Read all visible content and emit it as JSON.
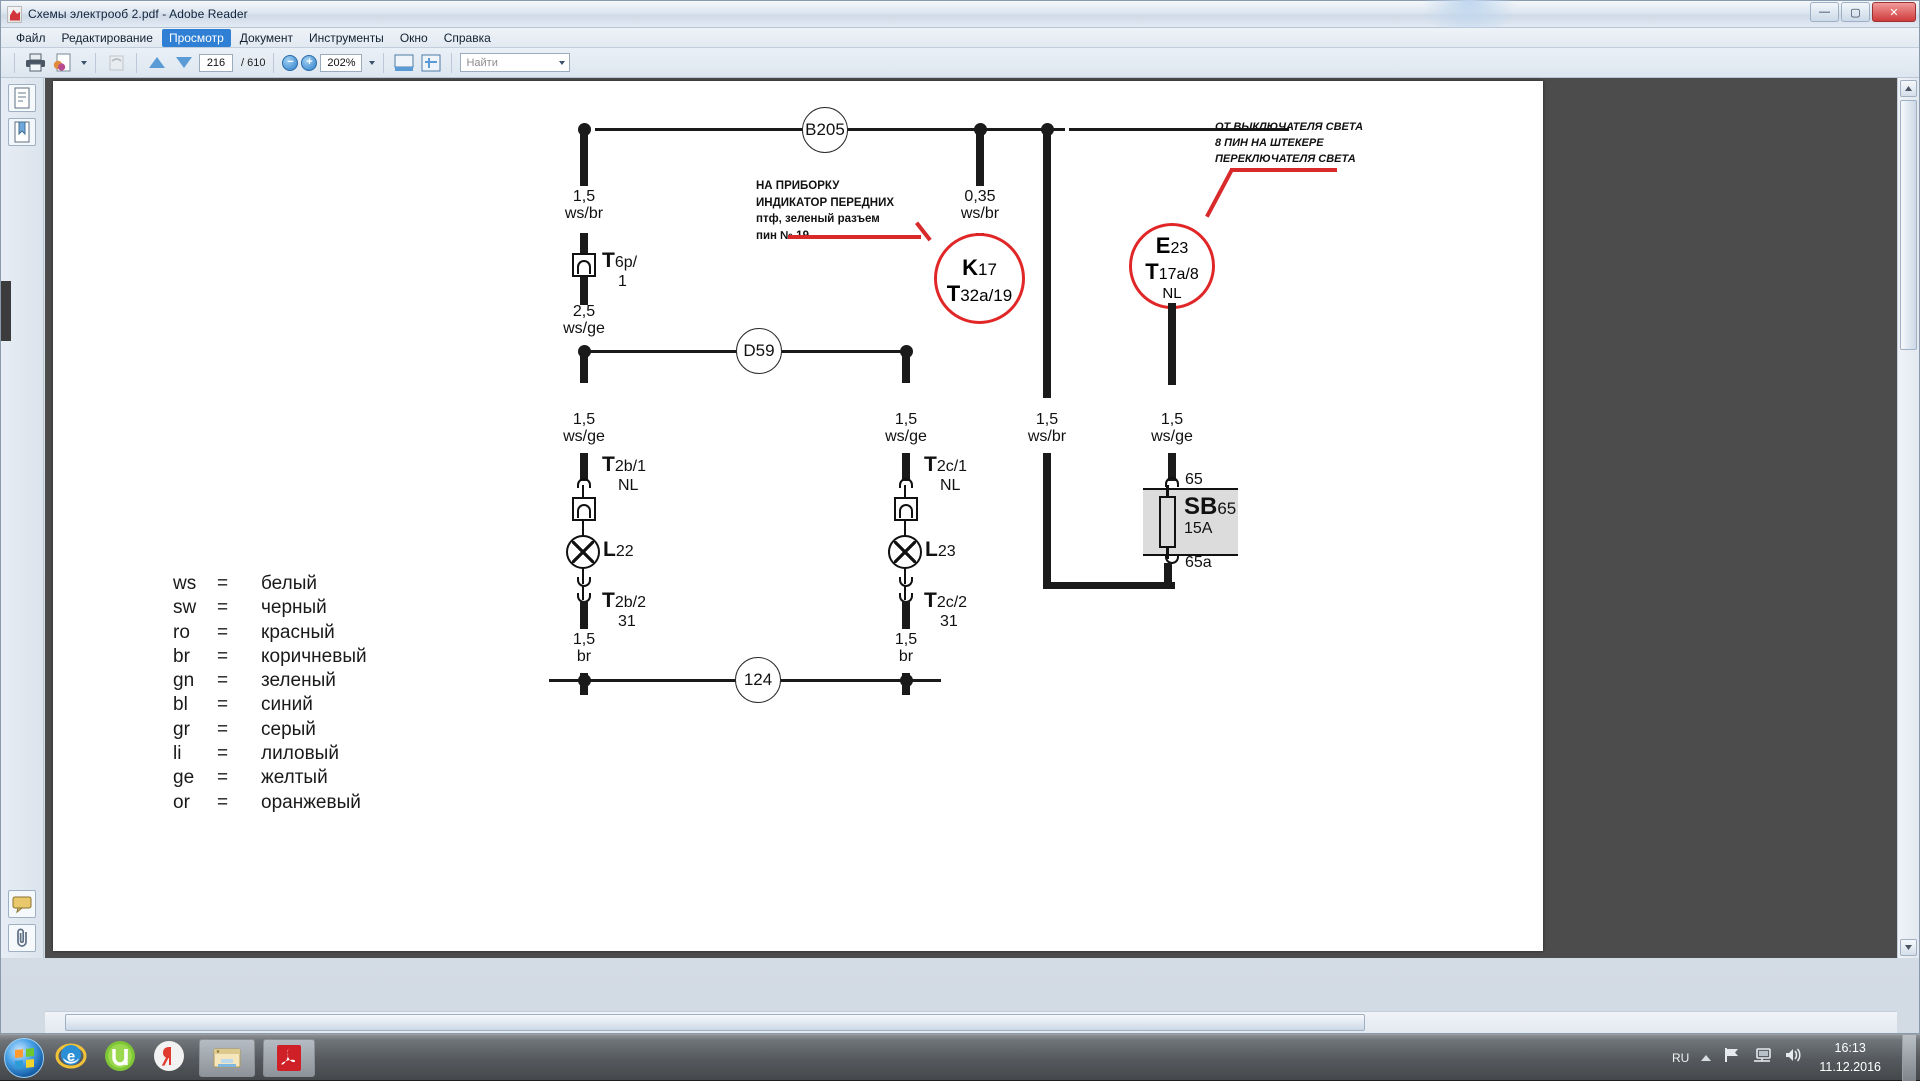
{
  "window": {
    "title": "Схемы электрооб 2.pdf - Adobe Reader",
    "icon": "pdf-icon",
    "buttons": {
      "minimize": "—",
      "maximize": "▢",
      "close": "✕"
    }
  },
  "menu": {
    "items": [
      {
        "label": "Файл",
        "active": false
      },
      {
        "label": "Редактирование",
        "active": false
      },
      {
        "label": "Просмотр",
        "active": true
      },
      {
        "label": "Документ",
        "active": false
      },
      {
        "label": "Инструменты",
        "active": false
      },
      {
        "label": "Окно",
        "active": false
      },
      {
        "label": "Справка",
        "active": false
      }
    ]
  },
  "toolbar": {
    "print_icon": "printer-icon",
    "email_icon": "email-attachment-icon",
    "undo_icon": "undo-icon",
    "prev_page_icon": "arrow-up-icon",
    "next_page_icon": "arrow-down-icon",
    "page_current": "216",
    "page_total": "/ 610",
    "zoom_out_icon": "zoom-out-icon",
    "zoom_in_icon": "zoom-in-icon",
    "zoom_value": "202%",
    "zoom_dropdown_icon": "chevron-down-icon",
    "fitwidth_icon": "fit-page-icon",
    "fullscreen_icon": "fullscreen-icon",
    "find_placeholder": "Найти",
    "find_value": "",
    "find_dropdown_icon": "chevron-down-icon"
  },
  "sidebar": {
    "items": [
      {
        "name": "pages-panel-icon"
      },
      {
        "name": "bookmarks-panel-icon"
      },
      {
        "name": "comments-panel-icon"
      },
      {
        "name": "attachments-panel-icon"
      }
    ]
  },
  "schematic": {
    "connectors": [
      {
        "id": "b205",
        "label": "B205"
      },
      {
        "id": "d59",
        "label": "D59"
      },
      {
        "id": "c124",
        "label": "124"
      }
    ],
    "wires": [
      {
        "id": "w1",
        "gauge": "1,5",
        "color": "ws/br"
      },
      {
        "id": "w2",
        "gauge": "2,5",
        "color": "ws/ge"
      },
      {
        "id": "w3",
        "gauge": "0,35",
        "color": "ws/br"
      },
      {
        "id": "w4",
        "gauge": "1,5",
        "color": "ws/ge"
      },
      {
        "id": "w5",
        "gauge": "1,5",
        "color": "ws/ge"
      },
      {
        "id": "w6",
        "gauge": "1,5",
        "color": "ws/br"
      },
      {
        "id": "w7",
        "gauge": "1,5",
        "color": "ws/ge"
      },
      {
        "id": "w8",
        "gauge": "1,5",
        "color": "br"
      },
      {
        "id": "w9",
        "gauge": "1,5",
        "color": "br"
      }
    ],
    "components": {
      "t6p": {
        "letter": "T",
        "sub": "6p/",
        "line2": "1"
      },
      "k17": {
        "letter": "K",
        "sub": "17",
        "letter2": "T",
        "sub2": "32a/19"
      },
      "e23": {
        "letter": "E",
        "sub": "23",
        "letter2": "T",
        "sub2": "17a/8",
        "line3": "NL"
      },
      "t2b1": {
        "letter": "T",
        "sub": "2b/1",
        "line2": "NL"
      },
      "t2c1": {
        "letter": "T",
        "sub": "2c/1",
        "line2": "NL"
      },
      "l22": {
        "letter": "L",
        "sub": "22"
      },
      "l23": {
        "letter": "L",
        "sub": "23"
      },
      "t2b2": {
        "letter": "T",
        "sub": "2b/2",
        "line2": "31"
      },
      "t2c2": {
        "letter": "T",
        "sub": "2c/2",
        "line2": "31"
      },
      "sb65": {
        "letter": "SB",
        "sub": "65",
        "rating": "15A",
        "terminal_top": "65",
        "terminal_bottom": "65a"
      }
    },
    "annotations": [
      {
        "id": "annot-k17",
        "lines": [
          "НА ПРИБОРКУ",
          "ИНДИКАТОР ПЕРЕДНИХ",
          "птф, зеленый разъем",
          "пин № 19"
        ],
        "color": "#d82a2a",
        "style": "bold"
      },
      {
        "id": "annot-e23",
        "lines": [
          "ОТ ВЫКЛЮЧАТЕЛЯ СВЕТА",
          "8 ПИН НА ШТЕКЕРЕ",
          "ПЕРЕКЛЮЧАТЕЛЯ СВЕТА"
        ],
        "color": "#d82a2a",
        "style": "italic-bold"
      }
    ]
  },
  "legend": {
    "rows": [
      {
        "abbr": "ws",
        "eq": "=",
        "name": "белый"
      },
      {
        "abbr": "sw",
        "eq": "=",
        "name": "черный"
      },
      {
        "abbr": "ro",
        "eq": "=",
        "name": "красный"
      },
      {
        "abbr": "br",
        "eq": "=",
        "name": "коричневый"
      },
      {
        "abbr": "gn",
        "eq": "=",
        "name": "зеленый"
      },
      {
        "abbr": "bl",
        "eq": "=",
        "name": "синий"
      },
      {
        "abbr": "gr",
        "eq": "=",
        "name": "серый"
      },
      {
        "abbr": "li",
        "eq": "=",
        "name": "лиловый"
      },
      {
        "abbr": "ge",
        "eq": "=",
        "name": "желтый"
      },
      {
        "abbr": "or",
        "eq": "=",
        "name": "оранжевый"
      }
    ]
  },
  "taskbar": {
    "start_icon": "windows-start-orb-icon",
    "pinned": [
      {
        "name": "internet-explorer-icon"
      },
      {
        "name": "utorrent-icon"
      },
      {
        "name": "yandex-browser-icon"
      }
    ],
    "windows": [
      {
        "name": "file-explorer-taskbar-button"
      },
      {
        "name": "adobe-reader-taskbar-button"
      }
    ],
    "tray": {
      "show_hidden_icon": "chevron-up-icon",
      "language": "RU",
      "flag_icon": "action-center-flag-icon",
      "network_icon": "network-icon",
      "volume_icon": "volume-icon",
      "time": "16:13",
      "date": "11.12.2016"
    }
  }
}
